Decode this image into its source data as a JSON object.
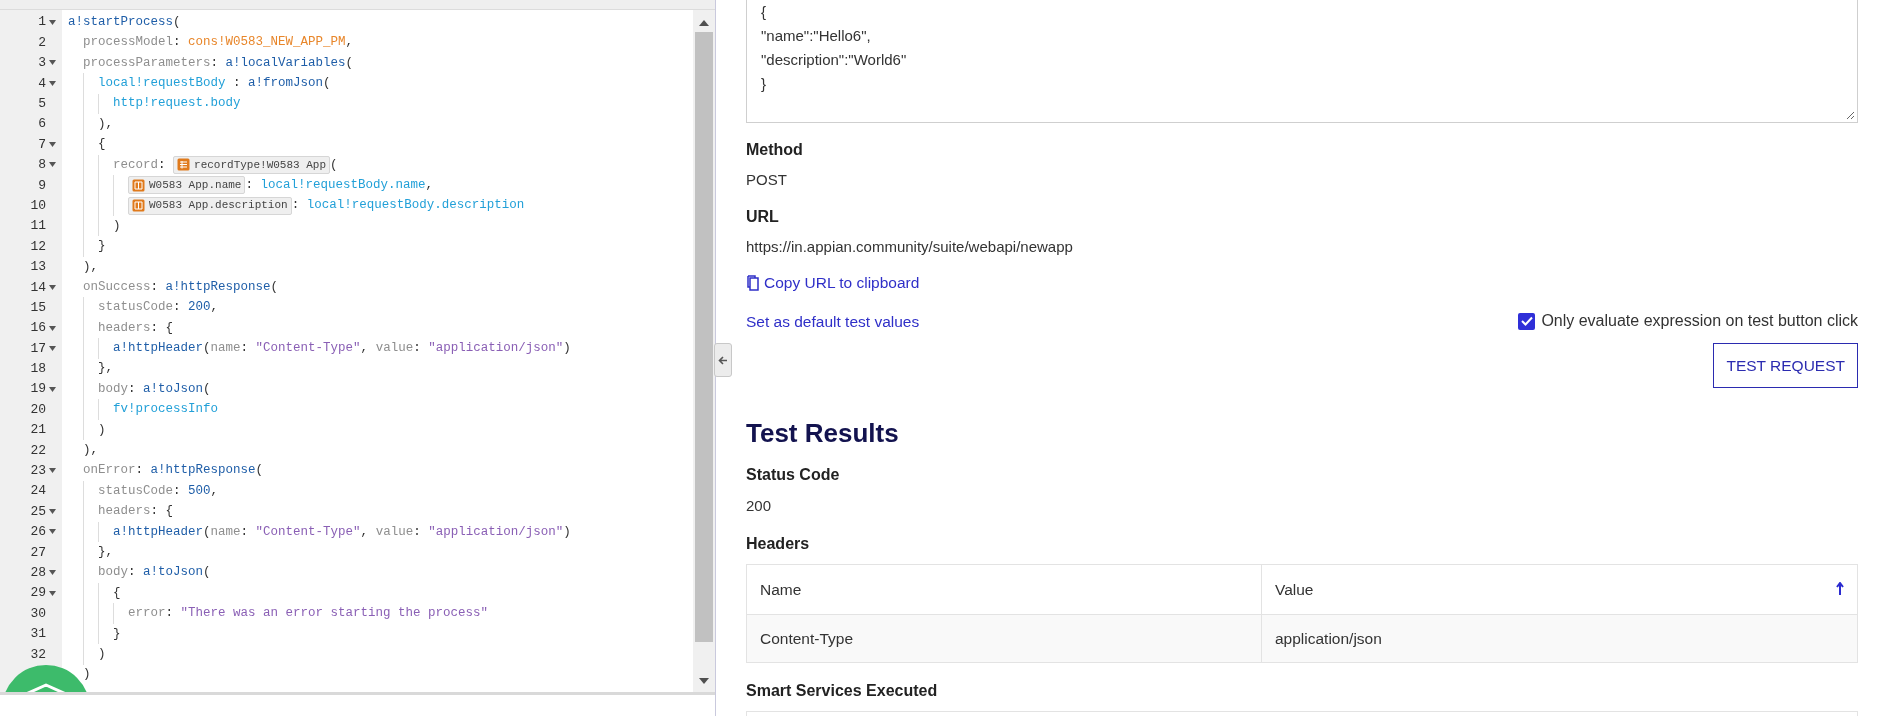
{
  "editor": {
    "lines": [
      {
        "number": "1",
        "foldable": true,
        "tokens": [
          {
            "kind": "func",
            "text": "a!startProcess"
          },
          {
            "kind": "punct",
            "text": "("
          }
        ]
      },
      {
        "number": "2",
        "foldable": false,
        "tokens": [
          {
            "kind": "param",
            "text": "  processModel"
          },
          {
            "kind": "punct",
            "text": ": "
          },
          {
            "kind": "const",
            "text": "cons!W0583_NEW_APP_PM"
          },
          {
            "kind": "punct",
            "text": ","
          }
        ]
      },
      {
        "number": "3",
        "foldable": true,
        "tokens": [
          {
            "kind": "param",
            "text": "  processParameters"
          },
          {
            "kind": "punct",
            "text": ": "
          },
          {
            "kind": "func",
            "text": "a!localVariables"
          },
          {
            "kind": "punct",
            "text": "("
          }
        ]
      },
      {
        "number": "4",
        "foldable": true,
        "tokens": [
          {
            "kind": "var",
            "text": "    local!requestBody"
          },
          {
            "kind": "punct",
            "text": " : "
          },
          {
            "kind": "func",
            "text": "a!fromJson"
          },
          {
            "kind": "punct",
            "text": "("
          }
        ]
      },
      {
        "number": "5",
        "foldable": false,
        "tokens": [
          {
            "kind": "var",
            "text": "      http!request.body"
          }
        ]
      },
      {
        "number": "6",
        "foldable": false,
        "tokens": [
          {
            "kind": "punct",
            "text": "    ),"
          }
        ]
      },
      {
        "number": "7",
        "foldable": true,
        "tokens": [
          {
            "kind": "punct",
            "text": "    {"
          }
        ]
      },
      {
        "number": "8",
        "foldable": true,
        "tokens": [
          {
            "kind": "param",
            "text": "      record"
          },
          {
            "kind": "punct",
            "text": ": "
          },
          {
            "kind": "chip-type",
            "text": "recordType!W0583 App"
          },
          {
            "kind": "punct",
            "text": "("
          }
        ]
      },
      {
        "number": "9",
        "foldable": false,
        "tokens": [
          {
            "kind": "chip-field",
            "text": "        W0583 App.name"
          },
          {
            "kind": "punct",
            "text": ": "
          },
          {
            "kind": "var",
            "text": "local!requestBody.name"
          },
          {
            "kind": "punct",
            "text": ","
          }
        ]
      },
      {
        "number": "10",
        "foldable": false,
        "tokens": [
          {
            "kind": "chip-field",
            "text": "        W0583 App.description"
          },
          {
            "kind": "punct",
            "text": ": "
          },
          {
            "kind": "var",
            "text": "local!requestBody.description"
          }
        ]
      },
      {
        "number": "11",
        "foldable": false,
        "tokens": [
          {
            "kind": "punct",
            "text": "      )"
          }
        ]
      },
      {
        "number": "12",
        "foldable": false,
        "tokens": [
          {
            "kind": "punct",
            "text": "    }"
          }
        ]
      },
      {
        "number": "13",
        "foldable": false,
        "tokens": [
          {
            "kind": "punct",
            "text": "  ),"
          }
        ]
      },
      {
        "number": "14",
        "foldable": true,
        "tokens": [
          {
            "kind": "param",
            "text": "  onSuccess"
          },
          {
            "kind": "punct",
            "text": ": "
          },
          {
            "kind": "func",
            "text": "a!httpResponse"
          },
          {
            "kind": "punct",
            "text": "("
          }
        ]
      },
      {
        "number": "15",
        "foldable": false,
        "tokens": [
          {
            "kind": "param",
            "text": "    statusCode"
          },
          {
            "kind": "punct",
            "text": ": "
          },
          {
            "kind": "num",
            "text": "200"
          },
          {
            "kind": "punct",
            "text": ","
          }
        ]
      },
      {
        "number": "16",
        "foldable": true,
        "tokens": [
          {
            "kind": "param",
            "text": "    headers"
          },
          {
            "kind": "punct",
            "text": ": {"
          }
        ]
      },
      {
        "number": "17",
        "foldable": true,
        "tokens": [
          {
            "kind": "func",
            "text": "      a!httpHeader"
          },
          {
            "kind": "punct",
            "text": "("
          },
          {
            "kind": "param",
            "text": "name"
          },
          {
            "kind": "punct",
            "text": ": "
          },
          {
            "kind": "string",
            "text": "\"Content-Type\""
          },
          {
            "kind": "punct",
            "text": ", "
          },
          {
            "kind": "param",
            "text": "value"
          },
          {
            "kind": "punct",
            "text": ": "
          },
          {
            "kind": "string",
            "text": "\"application/json\""
          },
          {
            "kind": "punct",
            "text": ")"
          }
        ]
      },
      {
        "number": "18",
        "foldable": false,
        "tokens": [
          {
            "kind": "punct",
            "text": "    },"
          }
        ]
      },
      {
        "number": "19",
        "foldable": true,
        "tokens": [
          {
            "kind": "param",
            "text": "    body"
          },
          {
            "kind": "punct",
            "text": ": "
          },
          {
            "kind": "func",
            "text": "a!toJson"
          },
          {
            "kind": "punct",
            "text": "("
          }
        ]
      },
      {
        "number": "20",
        "foldable": false,
        "tokens": [
          {
            "kind": "var",
            "text": "      fv!processInfo"
          }
        ]
      },
      {
        "number": "21",
        "foldable": false,
        "tokens": [
          {
            "kind": "punct",
            "text": "    )"
          }
        ]
      },
      {
        "number": "22",
        "foldable": false,
        "tokens": [
          {
            "kind": "punct",
            "text": "  ),"
          }
        ]
      },
      {
        "number": "23",
        "foldable": true,
        "tokens": [
          {
            "kind": "param",
            "text": "  onError"
          },
          {
            "kind": "punct",
            "text": ": "
          },
          {
            "kind": "func",
            "text": "a!httpResponse"
          },
          {
            "kind": "punct",
            "text": "("
          }
        ]
      },
      {
        "number": "24",
        "foldable": false,
        "tokens": [
          {
            "kind": "param",
            "text": "    statusCode"
          },
          {
            "kind": "punct",
            "text": ": "
          },
          {
            "kind": "num",
            "text": "500"
          },
          {
            "kind": "punct",
            "text": ","
          }
        ]
      },
      {
        "number": "25",
        "foldable": true,
        "tokens": [
          {
            "kind": "param",
            "text": "    headers"
          },
          {
            "kind": "punct",
            "text": ": {"
          }
        ]
      },
      {
        "number": "26",
        "foldable": true,
        "tokens": [
          {
            "kind": "func",
            "text": "      a!httpHeader"
          },
          {
            "kind": "punct",
            "text": "("
          },
          {
            "kind": "param",
            "text": "name"
          },
          {
            "kind": "punct",
            "text": ": "
          },
          {
            "kind": "string",
            "text": "\"Content-Type\""
          },
          {
            "kind": "punct",
            "text": ", "
          },
          {
            "kind": "param",
            "text": "value"
          },
          {
            "kind": "punct",
            "text": ": "
          },
          {
            "kind": "string",
            "text": "\"application/json\""
          },
          {
            "kind": "punct",
            "text": ")"
          }
        ]
      },
      {
        "number": "27",
        "foldable": false,
        "tokens": [
          {
            "kind": "punct",
            "text": "    },"
          }
        ]
      },
      {
        "number": "28",
        "foldable": true,
        "tokens": [
          {
            "kind": "param",
            "text": "    body"
          },
          {
            "kind": "punct",
            "text": ": "
          },
          {
            "kind": "func",
            "text": "a!toJson"
          },
          {
            "kind": "punct",
            "text": "("
          }
        ]
      },
      {
        "number": "29",
        "foldable": true,
        "tokens": [
          {
            "kind": "punct",
            "text": "      {"
          }
        ]
      },
      {
        "number": "30",
        "foldable": false,
        "tokens": [
          {
            "kind": "param",
            "text": "        error"
          },
          {
            "kind": "punct",
            "text": ": "
          },
          {
            "kind": "string",
            "text": "\"There was an error starting the process\""
          }
        ]
      },
      {
        "number": "31",
        "foldable": false,
        "tokens": [
          {
            "kind": "punct",
            "text": "      }"
          }
        ]
      },
      {
        "number": "32",
        "foldable": false,
        "tokens": [
          {
            "kind": "punct",
            "text": "    )"
          }
        ]
      },
      {
        "tokens": [
          {
            "kind": "punct",
            "text": "  )"
          }
        ]
      }
    ]
  },
  "request_body": {
    "lines": [
      "{",
      "\"name\":\"Hello6\",",
      "\"description\":\"World6\"",
      "}"
    ]
  },
  "method": {
    "label": "Method",
    "value": "POST"
  },
  "url": {
    "label": "URL",
    "value": "https://in.appian.community/suite/webapi/newapp"
  },
  "copy_link": "Copy URL to clipboard",
  "default_link": "Set as default test values",
  "evaluate_option": {
    "label": "Only evaluate expression on test button click",
    "checked": true
  },
  "test_button": "TEST REQUEST",
  "results": {
    "title": "Test Results",
    "status": {
      "label": "Status Code",
      "value": "200"
    },
    "headers": {
      "label": "Headers",
      "columns": [
        "Name",
        "Value"
      ],
      "rows": [
        [
          "Content-Type",
          "application/json"
        ]
      ]
    },
    "smart_services": {
      "label": "Smart Services Executed"
    }
  }
}
